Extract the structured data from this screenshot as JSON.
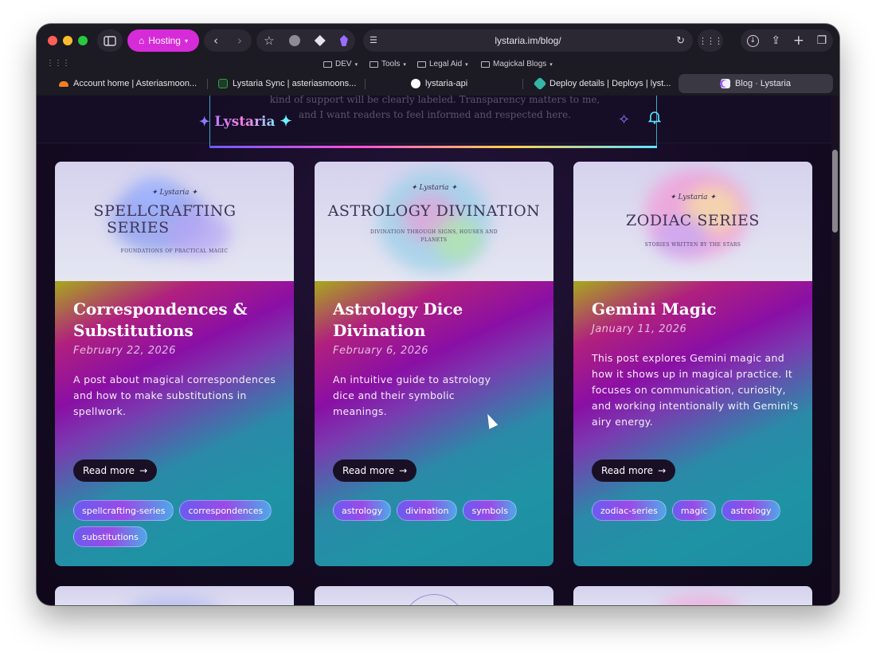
{
  "browser": {
    "profile_button": "Hosting",
    "address": "lystaria.im/blog/",
    "bookmarks": [
      "DEV",
      "Tools",
      "Legal Aid",
      "Magickal Blogs"
    ],
    "tabs": [
      {
        "label": "Account home | Asteriasmoon...",
        "color": "#f38020"
      },
      {
        "label": "Lystaria Sync | asteriasmoons...",
        "color": "#2ea043"
      },
      {
        "label": "lystaria-api",
        "color": "#ffffff"
      },
      {
        "label": "Deploy details | Deploys | lyst...",
        "color": "#32b6a8"
      },
      {
        "label": "Blog · Lystaria",
        "color": "#a35cff",
        "active": true
      }
    ],
    "icons": {
      "sidebar": "sidebar-icon",
      "back": "back-icon",
      "forward": "forward-icon",
      "bookmark": "star-icon",
      "pinterest": "pinterest-icon",
      "apps": "grid-icon",
      "reload": "reload-icon",
      "download": "download-icon",
      "share": "share-icon",
      "new_tab": "plus-icon",
      "tabs_overview": "tabs-icon"
    }
  },
  "site": {
    "logo": "Lystaria",
    "modal_text_line1": "kind of support will be clearly labeled. Transparency matters to me,",
    "modal_text_line2": "and I want readers to feel informed and respected here."
  },
  "cards": [
    {
      "image_brand": "Lystaria",
      "image_title_line1": "SPELLCRAFTING",
      "image_title_line2": "SERIES",
      "image_subtitle": "FOUNDATIONS OF PRACTICAL MAGIC",
      "title": "Correspondences & Substitutions",
      "date": "February 22, 2026",
      "description": "A post about magical correspondences and how to make substitutions in spellwork.",
      "read_more": "Read more",
      "tags": [
        "spellcrafting-series",
        "correspondences",
        "substitutions"
      ]
    },
    {
      "image_brand": "Lystaria",
      "image_title_line1": "ASTROLOGY DIVINATION",
      "image_title_line2": "",
      "image_subtitle": "DIVINATION THROUGH SIGNS, HOUSES AND PLANETS",
      "title": "Astrology Dice Divination",
      "date": "February 6, 2026",
      "description": "An intuitive guide to astrology dice and their symbolic meanings.",
      "read_more": "Read more",
      "tags": [
        "astrology",
        "divination",
        "symbols"
      ]
    },
    {
      "image_brand": "Lystaria",
      "image_title_line1": "ZODIAC SERIES",
      "image_title_line2": "",
      "image_subtitle": "STORIES WRITTEN BY THE STARS",
      "title": "Gemini Magic",
      "date": "January 11, 2026",
      "description": "This post explores Gemini magic and how it shows up in magical practice. It focuses on communication, curiosity, and working intentionally with Gemini's airy energy.",
      "read_more": "Read more",
      "tags": [
        "zodiac-series",
        "magic",
        "astrology"
      ]
    }
  ]
}
